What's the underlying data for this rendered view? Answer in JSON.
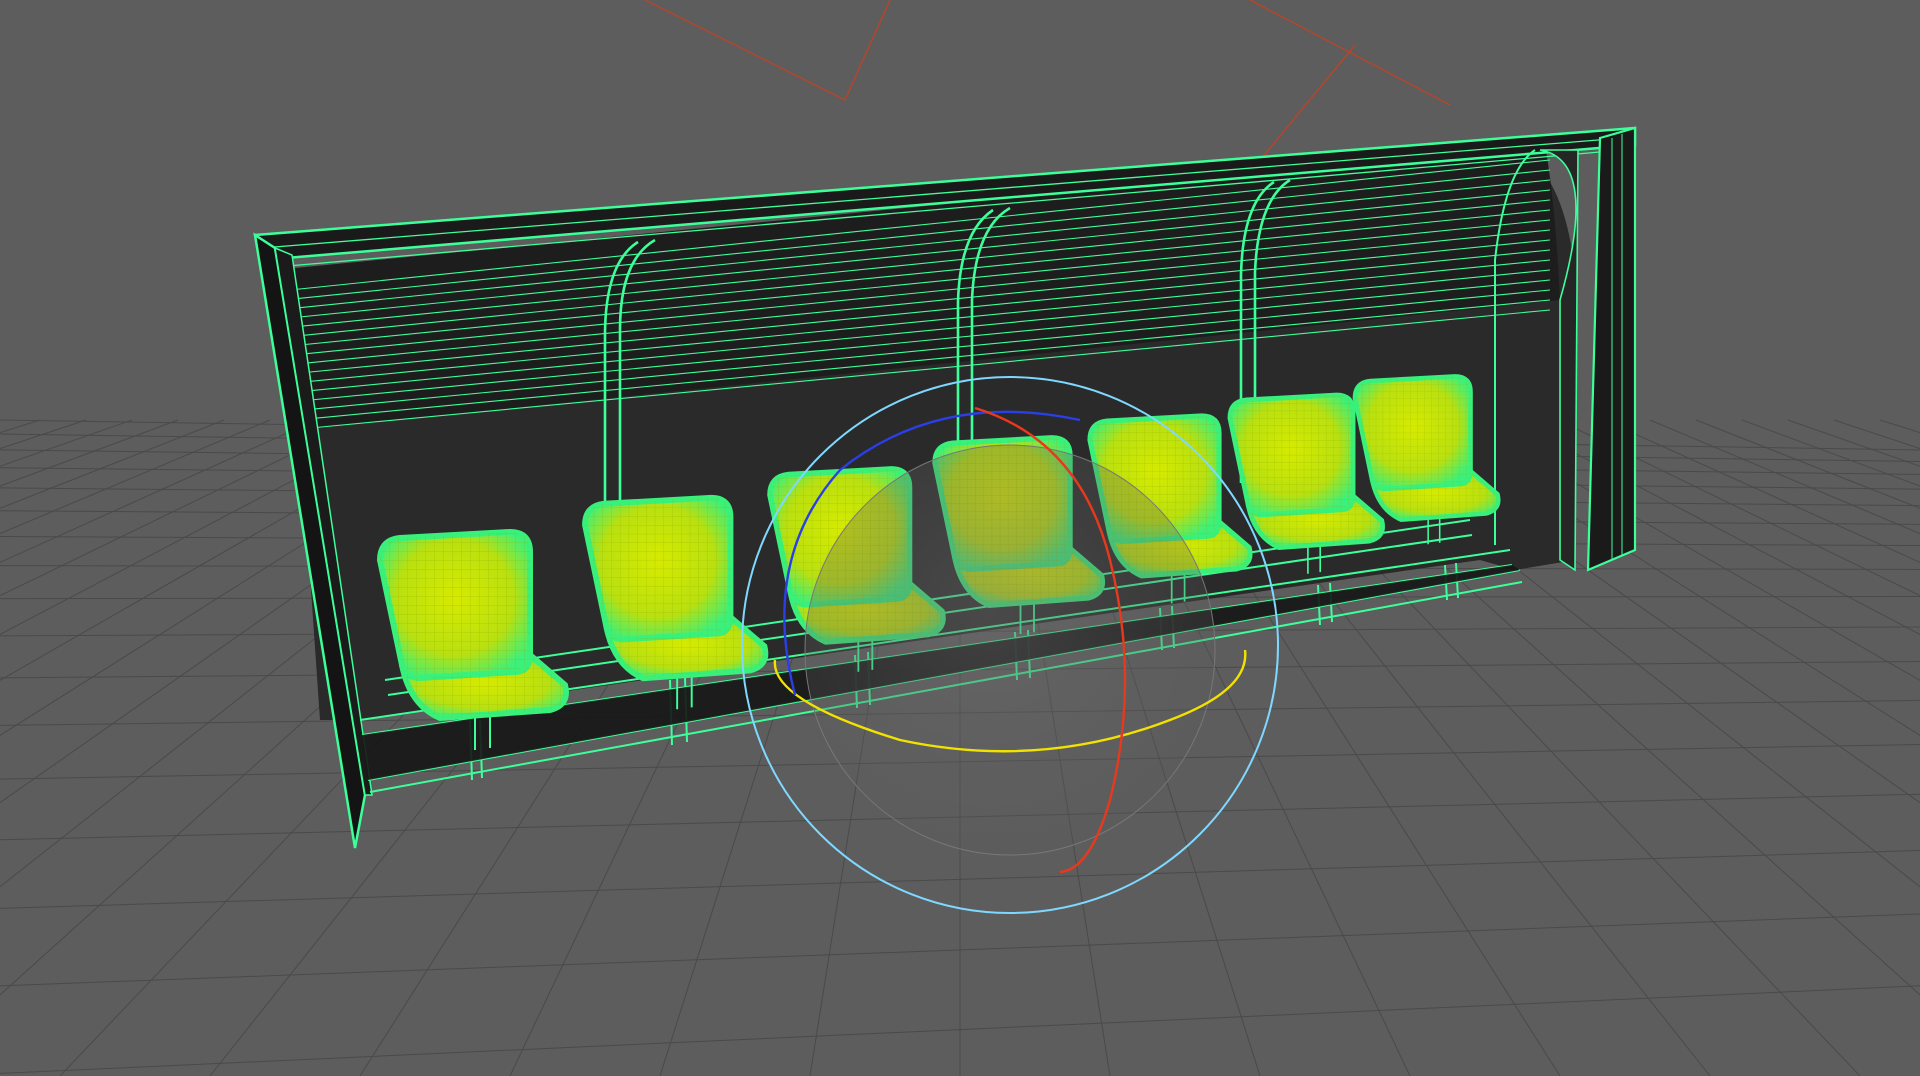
{
  "viewport": {
    "background": "#5d5d5d",
    "grid_color": "#4a4a4a",
    "grid_dark_color": "#3f3f3f"
  },
  "model": {
    "name": "dugout-bench",
    "wire_color": "#3dff9a",
    "shell_fill": "#1a1a1a",
    "interior_fill": "#2c2c2c",
    "seat_count": 7,
    "seat_fill": "#c9e600",
    "seat_glow": "#39f07a",
    "selected": true
  },
  "manipulator": {
    "type": "rotate",
    "outer_ring_color": "#7fd8ff",
    "x_axis_color": "#e8391c",
    "y_axis_color": "#f2e200",
    "z_axis_color": "#2a3fe8",
    "sphere_color": "#6d6d6d"
  },
  "camera_lines_color": "#b7452a"
}
